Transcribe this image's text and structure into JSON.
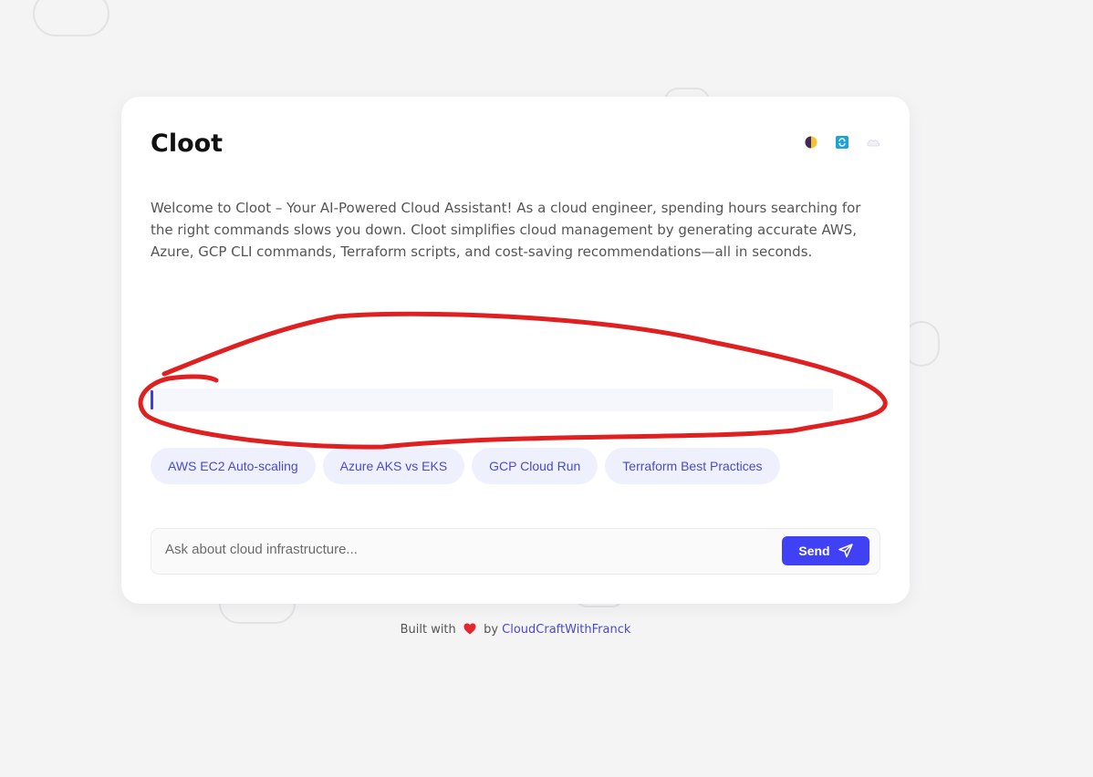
{
  "app": {
    "title": "Cloot",
    "description": "Welcome to Cloot – Your AI-Powered Cloud Assistant! As a cloud engineer, spending hours searching for the right commands slows you down. Cloot simplifies cloud management by generating accurate AWS, Azure, GCP CLI commands, Terraform scripts, and cost-saving recommendations—all in seconds."
  },
  "header_icons": [
    "theme-toggle-icon",
    "refresh-icon",
    "cloud-icon"
  ],
  "suggestions": [
    "AWS EC2 Auto-scaling",
    "Azure AKS vs EKS",
    "GCP Cloud Run",
    "Terraform Best Practices"
  ],
  "input": {
    "placeholder": "Ask about cloud infrastructure...",
    "value": ""
  },
  "send_button": {
    "label": "Send"
  },
  "footer": {
    "prefix": "Built with",
    "middle": "by",
    "link_text": "CloudCraftWithFranck"
  },
  "colors": {
    "accent": "#4040f4",
    "chip_bg": "#eff0fd",
    "annotation": "#e02020"
  }
}
